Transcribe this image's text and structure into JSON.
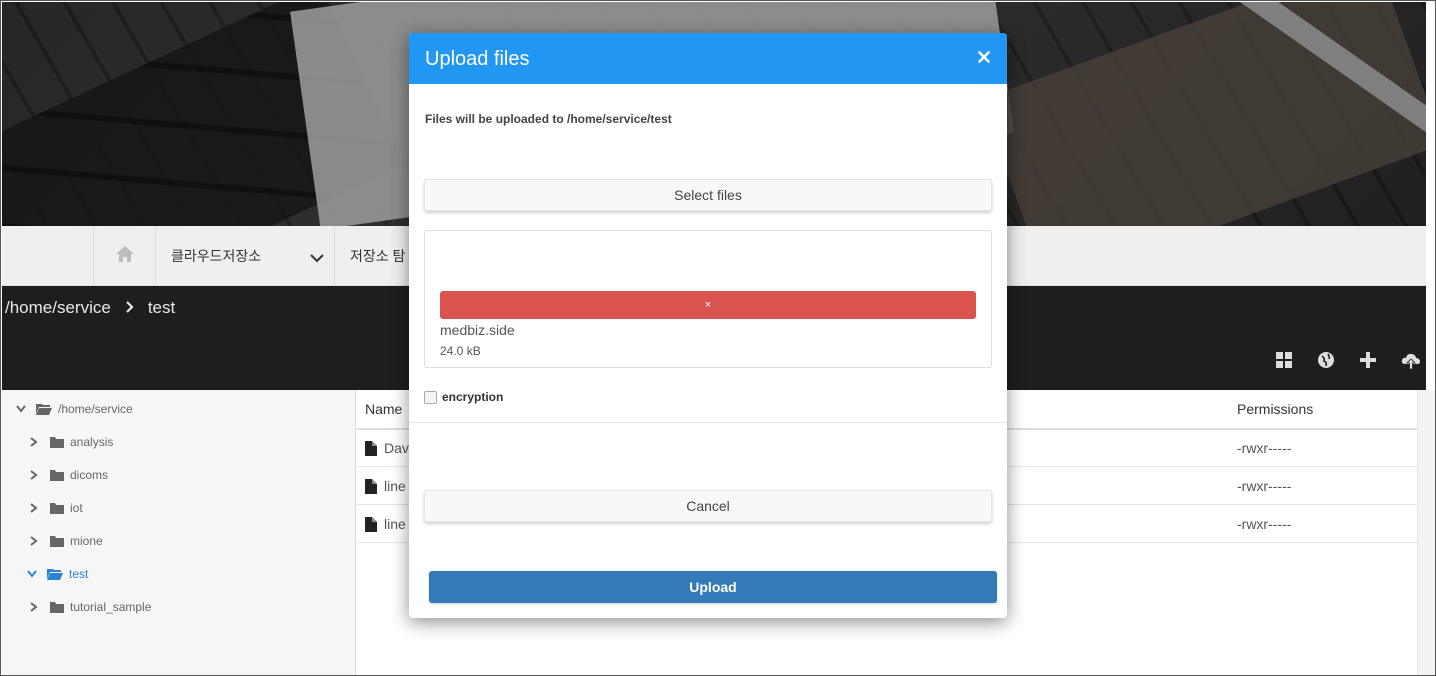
{
  "nav": {
    "home_icon": "home-icon",
    "menu1_label": "클라우드저장소",
    "menu2_label": "저장소 탐"
  },
  "breadcrumb": {
    "root": "/home/service",
    "current": "test"
  },
  "toolbar": {
    "icons": [
      "grid-icon",
      "globe-icon",
      "plus-icon",
      "cloud-upload-icon"
    ]
  },
  "tree": {
    "root_label": "/home/service",
    "items": [
      {
        "label": "analysis"
      },
      {
        "label": "dicoms"
      },
      {
        "label": "iot"
      },
      {
        "label": "mione"
      },
      {
        "label": "test"
      },
      {
        "label": "tutorial_sample"
      }
    ]
  },
  "table": {
    "headers": {
      "name": "Name",
      "permissions": "Permissions"
    },
    "rows": [
      {
        "name": "Dav",
        "permissions": "-rwxr-----"
      },
      {
        "name": "line",
        "permissions": "-rwxr-----"
      },
      {
        "name": "line",
        "permissions": "-rwxr-----"
      }
    ]
  },
  "modal": {
    "title": "Upload files",
    "path_text": "Files will be uploaded to /home/service/test",
    "select_label": "Select files",
    "remove_label": "×",
    "file_name": "medbiz.side",
    "file_size": "24.0 kB",
    "encryption_label": "encryption",
    "cancel_label": "Cancel",
    "upload_label": "Upload"
  },
  "colors": {
    "header": "#2196f3",
    "danger": "#d9534f",
    "primary": "#337ab7",
    "tree_active": "#2a84d4"
  }
}
